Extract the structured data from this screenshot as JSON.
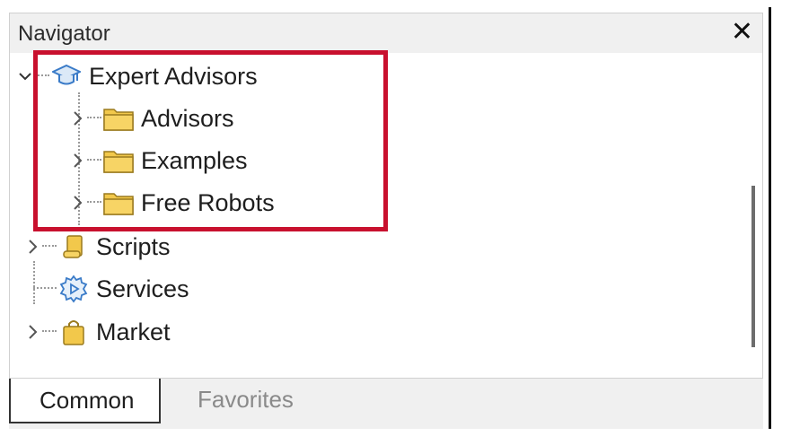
{
  "panel": {
    "title": "Navigator",
    "close_symbol": "✕"
  },
  "tree": {
    "items": [
      {
        "label": "Expert Advisors",
        "icon": "graduation-cap-icon",
        "expanded": true,
        "level": 0
      },
      {
        "label": "Advisors",
        "icon": "folder-icon",
        "expanded": false,
        "level": 1
      },
      {
        "label": "Examples",
        "icon": "folder-icon",
        "expanded": false,
        "level": 1
      },
      {
        "label": "Free Robots",
        "icon": "folder-icon",
        "expanded": false,
        "level": 1
      },
      {
        "label": "Scripts",
        "icon": "scroll-icon",
        "expanded": false,
        "level": 0
      },
      {
        "label": "Services",
        "icon": "gear-play-icon",
        "expanded": null,
        "level": 0
      },
      {
        "label": "Market",
        "icon": "shopping-bag-icon",
        "expanded": false,
        "level": 0
      }
    ]
  },
  "tabs": [
    {
      "label": "Common",
      "active": true
    },
    {
      "label": "Favorites",
      "active": false
    }
  ],
  "colors": {
    "highlight": "#c8102e",
    "folder": "#f2c84b",
    "icon_blue": "#4a90d9"
  }
}
